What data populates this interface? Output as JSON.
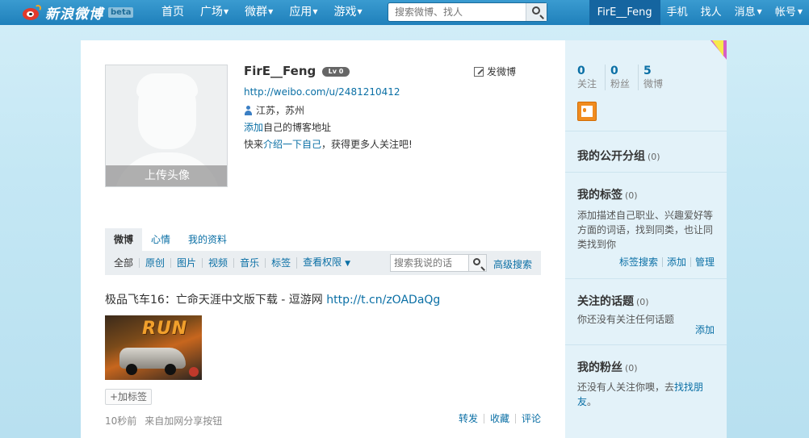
{
  "topbar": {
    "logo_text": "新浪微博",
    "logo_badge": "beta",
    "nav": [
      {
        "label": "首页",
        "dropdown": false
      },
      {
        "label": "广场",
        "dropdown": true
      },
      {
        "label": "微群",
        "dropdown": true
      },
      {
        "label": "应用",
        "dropdown": true
      },
      {
        "label": "游戏",
        "dropdown": true
      }
    ],
    "search_placeholder": "搜索微博、找人",
    "right_nav": {
      "user": "FirE__Feng",
      "phone": "手机",
      "find": "找人",
      "messages": "消息",
      "account": "帐号"
    }
  },
  "profile": {
    "upload_avatar": "上传头像",
    "username": "FirE__Feng",
    "level_badge": "Lv 0",
    "post_label": "发微博",
    "url": "http://weibo.com/u/2481210412",
    "location": "江苏，苏州",
    "blog_link": "添加",
    "blog_text": "自己的博客地址",
    "intro_prefix": "快来",
    "intro_link": "介绍一下自己",
    "intro_suffix": "，获得更多人关注吧!"
  },
  "tabs": [
    "微博",
    "心情",
    "我的资料"
  ],
  "filters": {
    "items": [
      "全部",
      "原创",
      "图片",
      "视频",
      "音乐",
      "标签"
    ],
    "permission": "查看权限",
    "search_placeholder": "搜索我说的话",
    "advanced": "高级搜索"
  },
  "feed": {
    "text": "极品飞车16：亡命天涯中文版下载 - 逗游网 ",
    "link": "http://t.cn/zOADaQg",
    "image_title": "RUN",
    "add_tag": "+加标签",
    "time": "10秒前",
    "source": "来自加网分享按钮",
    "actions": [
      "转发",
      "收藏",
      "评论"
    ]
  },
  "sidebar": {
    "stats": [
      {
        "num": "0",
        "label": "关注"
      },
      {
        "num": "0",
        "label": "粉丝"
      },
      {
        "num": "5",
        "label": "微博"
      }
    ],
    "groups": {
      "title": "我的公开分组",
      "count": "(0)"
    },
    "tags": {
      "title": "我的标签",
      "count": "(0)",
      "desc": "添加描述自己职业、兴趣爱好等方面的词语，找到同类，也让同类找到你",
      "links": [
        "标签搜索",
        "添加",
        "管理"
      ]
    },
    "topics": {
      "title": "关注的话题",
      "count": "(0)",
      "desc": "你还没有关注任何话题",
      "link": "添加"
    },
    "fans": {
      "title": "我的粉丝",
      "count": "(0)",
      "desc_prefix": "还没有人关注你噢，去",
      "desc_link": "找找朋友",
      "desc_suffix": "。"
    }
  },
  "colors": {
    "topbar": "#1f80bb",
    "link": "#0a6fa5",
    "sidebar": "#e3f2f9",
    "background": "#c4e7f4"
  }
}
